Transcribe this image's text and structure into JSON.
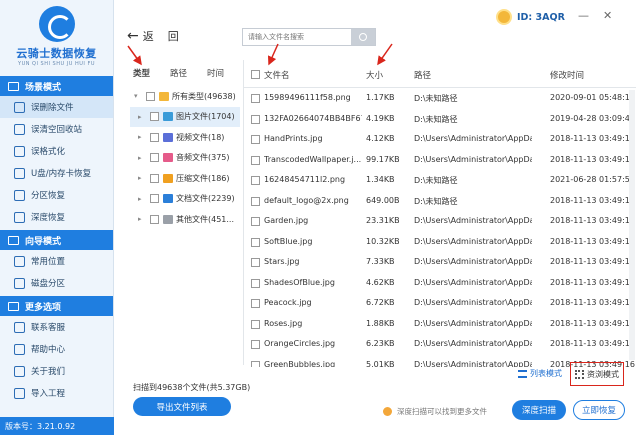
{
  "app": {
    "logo_name": "云骑士数据恢复",
    "logo_sub": "YUN QI SHI SHU JU HUI FU",
    "version": "版本号：3.21.0.92"
  },
  "topbar": {
    "user_id": "ID: 3AQR",
    "minimize": "—",
    "close": "✕"
  },
  "nav": {
    "back_label": "返",
    "forward_label": "回",
    "search_placeholder": "请输入文件名搜索"
  },
  "sidebar": {
    "sections": [
      {
        "title": "场景模式",
        "items": [
          "误删除文件",
          "误清空回收站",
          "误格式化",
          "U盘/内存卡恢复",
          "分区恢复",
          "深度恢复"
        ]
      },
      {
        "title": "向导模式",
        "items": [
          "常用位置",
          "磁盘分区"
        ]
      },
      {
        "title": "更多选项",
        "items": [
          "联系客服",
          "帮助中心",
          "关于我们",
          "导入工程"
        ]
      }
    ]
  },
  "tree": {
    "tabs": [
      "类型",
      "路径",
      "时间"
    ],
    "items": [
      {
        "label": "所有类型(49638)",
        "color": "#f3b73a"
      },
      {
        "label": "图片文件(1704)",
        "color": "#3a9bd8"
      },
      {
        "label": "视频文件(18)",
        "color": "#5b6fd8"
      },
      {
        "label": "音频文件(375)",
        "color": "#e55b8a"
      },
      {
        "label": "压缩文件(186)",
        "color": "#f0a020"
      },
      {
        "label": "文档文件(2239)",
        "color": "#2b7fd9"
      },
      {
        "label": "其他文件(451...",
        "color": "#9aa0a8"
      }
    ]
  },
  "table": {
    "headers": {
      "name": "文件名",
      "size": "大小",
      "path": "路径",
      "date": "修改时间"
    },
    "rows": [
      {
        "name": "15989496111f58.png",
        "size": "1.17KB",
        "path": "D:\\未知路径",
        "date": "2020-09-01 05:48:16"
      },
      {
        "name": "132FA02664074BB4BF67...",
        "size": "4.19KB",
        "path": "D:\\未知路径",
        "date": "2019-04-28 03:09:46"
      },
      {
        "name": "HandPrints.jpg",
        "size": "4.12KB",
        "path": "D:\\Users\\Administrator\\AppData...",
        "date": "2018-11-13 03:49:16"
      },
      {
        "name": "TranscodedWallpaper.j...",
        "size": "99.17KB",
        "path": "D:\\Users\\Administrator\\AppData...",
        "date": "2018-11-13 03:49:16"
      },
      {
        "name": "16248454711l2.png",
        "size": "1.34KB",
        "path": "D:\\未知路径",
        "date": "2021-06-28 01:57:59"
      },
      {
        "name": "default_logo@2x.png",
        "size": "649.00B",
        "path": "D:\\未知路径",
        "date": "2018-11-13 03:49:16"
      },
      {
        "name": "Garden.jpg",
        "size": "23.31KB",
        "path": "D:\\Users\\Administrator\\AppData...",
        "date": "2018-11-13 03:49:16"
      },
      {
        "name": "SoftBlue.jpg",
        "size": "10.32KB",
        "path": "D:\\Users\\Administrator\\AppData...",
        "date": "2018-11-13 03:49:16"
      },
      {
        "name": "Stars.jpg",
        "size": "7.33KB",
        "path": "D:\\Users\\Administrator\\AppData...",
        "date": "2018-11-13 03:49:16"
      },
      {
        "name": "ShadesOfBlue.jpg",
        "size": "4.62KB",
        "path": "D:\\Users\\Administrator\\AppData...",
        "date": "2018-11-13 03:49:16"
      },
      {
        "name": "Peacock.jpg",
        "size": "6.72KB",
        "path": "D:\\Users\\Administrator\\AppData...",
        "date": "2018-11-13 03:49:16"
      },
      {
        "name": "Roses.jpg",
        "size": "1.88KB",
        "path": "D:\\Users\\Administrator\\AppData...",
        "date": "2018-11-13 03:49:16"
      },
      {
        "name": "OrangeCircles.jpg",
        "size": "6.23KB",
        "path": "D:\\Users\\Administrator\\AppData...",
        "date": "2018-11-13 03:49:16"
      },
      {
        "name": "GreenBubbles.jpg",
        "size": "5.01KB",
        "path": "D:\\Users\\Administrator\\AppData...",
        "date": "2018-11-13 03:49:16"
      }
    ]
  },
  "footer": {
    "scan_info": "扫描到49638个文件(共5.37GB)",
    "export_label": "导出文件列表",
    "list_view_label": "列表模式",
    "thumb_view_label": "资浏模式",
    "tip": "深度扫描可以找到更多文件",
    "deep_scan_label": "深度扫描",
    "recover_label": "立即恢复"
  },
  "colors": {
    "primary": "#1f7ee0",
    "annotation": "#d9261c"
  }
}
